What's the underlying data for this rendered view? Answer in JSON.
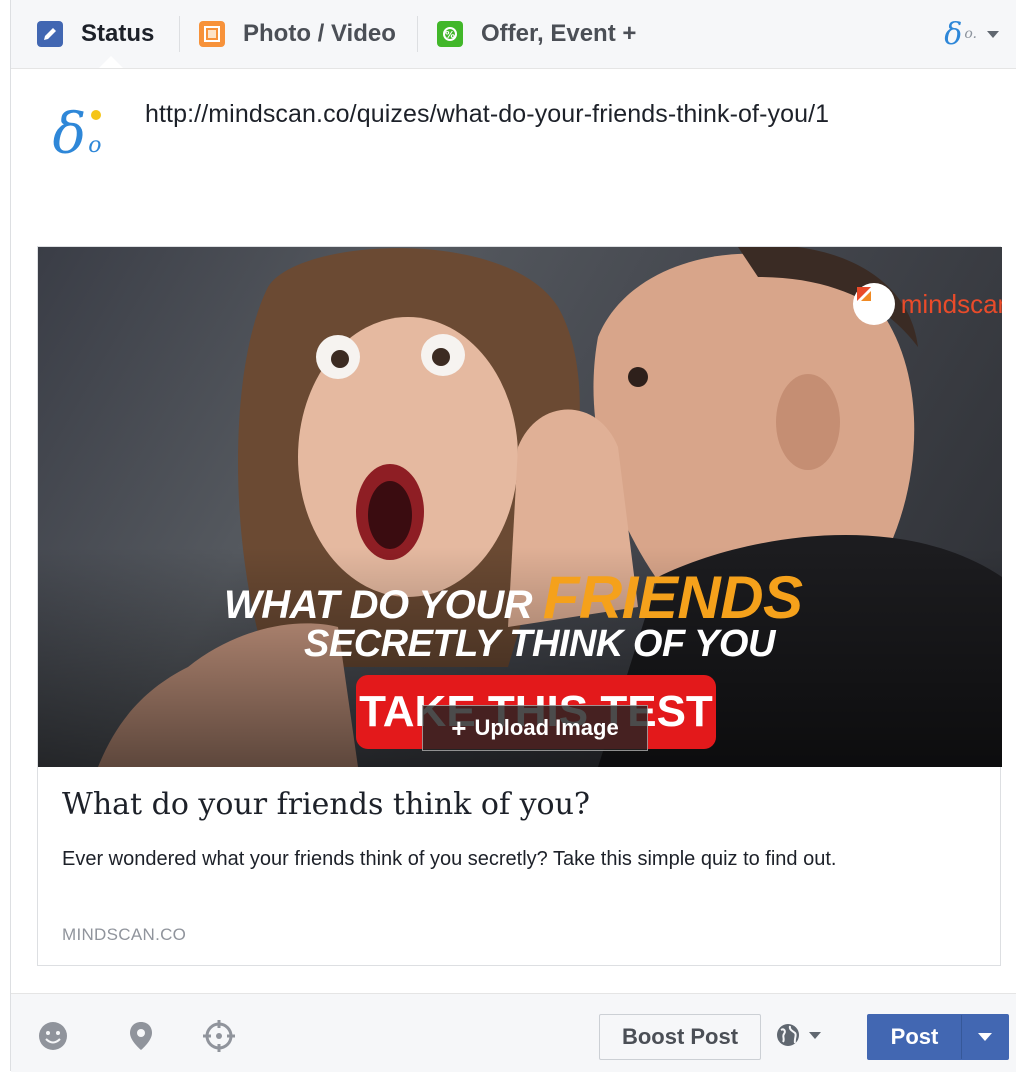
{
  "tabs": {
    "status": "Status",
    "photo_video": "Photo / Video",
    "offer_event": "Offer, Event +"
  },
  "composer": {
    "text": "http://mindscan.co/quizes/what-do-your-friends-think-of-you/1",
    "page_avatar_text": "δo"
  },
  "preview": {
    "brand": "mindscan",
    "headline_part1": "WHAT DO YOUR ",
    "headline_accent": "FRIENDS",
    "headline_line2": "SECRETLY THINK OF YOU",
    "cta": "TAKE THIS TEST",
    "upload_label": "Upload Image",
    "upload_icon": "+",
    "title": "What do your friends think of you?",
    "description": "Ever wondered what your friends think of you secretly? Take this simple quiz to find out.",
    "domain": "MINDSCAN.CO"
  },
  "footer": {
    "boost_label": "Boost Post",
    "post_label": "Post",
    "icons": [
      "emoji-icon",
      "location-pin-icon",
      "target-icon",
      "globe-icon"
    ]
  },
  "colors": {
    "facebook_blue": "#4267b2",
    "cta_red": "#e3191b",
    "headline_orange": "#f5a11b",
    "page_logo_blue": "#2e87d8"
  }
}
